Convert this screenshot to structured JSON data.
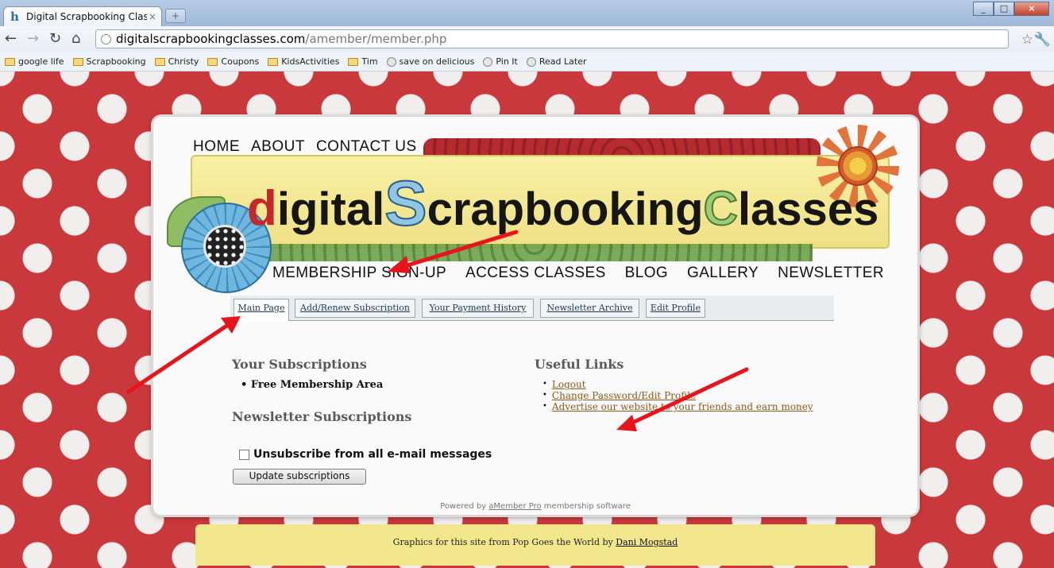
{
  "browser": {
    "tab_title": "Digital Scrapbooking Classe",
    "tab_close": "×",
    "new_tab": "+",
    "url_host": "digitalscrapbookingclasses.com",
    "url_path": "/amember/member.php",
    "bookmarks": [
      "google life",
      "Scrapbooking",
      "Christy",
      "Coupons",
      "KidsActivities",
      "Tim",
      "save on delicious",
      "Pin It",
      "Read Later"
    ]
  },
  "site": {
    "top_nav": [
      "HOME",
      "ABOUT",
      "CONTACT US"
    ],
    "logo": {
      "d": "d",
      "igital": "igital",
      "S": "S",
      "crapbooking": "crapbooking",
      "C": "C",
      "lasses": "lasses"
    },
    "sub_nav": [
      "MEMBERSHIP SIGN-UP",
      "ACCESS CLASSES",
      "BLOG",
      "GALLERY",
      "NEWSLETTER"
    ]
  },
  "member": {
    "tabs": [
      "Main Page",
      "Add/Renew Subscription",
      "Your Payment History",
      "Newsletter Archive",
      "Edit Profile"
    ],
    "active_tab": "Main Page",
    "subscriptions_heading": "Your Subscriptions",
    "subscriptions": [
      "Free Membership Area"
    ],
    "newsletter_heading": "Newsletter Subscriptions",
    "unsubscribe_label": "Unsubscribe from all e-mail messages",
    "unsubscribe_checked": false,
    "update_button": "Update subscriptions",
    "useful_links_heading": "Useful Links",
    "useful_links": [
      "Logout",
      "Change Password/Edit Profile",
      "Advertise our website to your friends and earn money"
    ],
    "powered_prefix": "Powered by",
    "powered_link": "aMember Pro",
    "powered_suffix": "membership software"
  },
  "footer": {
    "text": "Graphics for this site from Pop Goes the World by",
    "link": "Dani Mogstad"
  },
  "colors": {
    "background_red": "#c9383b",
    "banner_yellow": "#f8f0a4",
    "footer_yellow": "#f3e78e",
    "annotation_red": "#e8141b"
  }
}
